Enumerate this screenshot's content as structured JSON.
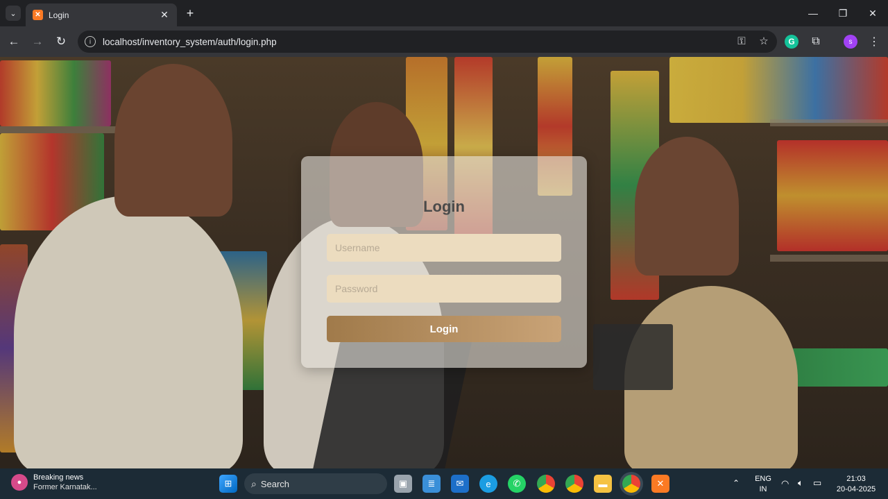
{
  "browser": {
    "tab_title": "Login",
    "url": "localhost/inventory_system/auth/login.php",
    "profile_initial": "s"
  },
  "login": {
    "title": "Login",
    "username_placeholder": "Username",
    "password_placeholder": "Password",
    "button_label": "Login"
  },
  "taskbar": {
    "news_title": "Breaking news",
    "news_subtitle": "Former Karnatak...",
    "search_label": "Search",
    "language_line1": "ENG",
    "language_line2": "IN",
    "time": "21:03",
    "date": "20-04-2025"
  },
  "colors": {
    "accent_button": "#b28b5e",
    "field_bg": "#ecdcbf"
  }
}
